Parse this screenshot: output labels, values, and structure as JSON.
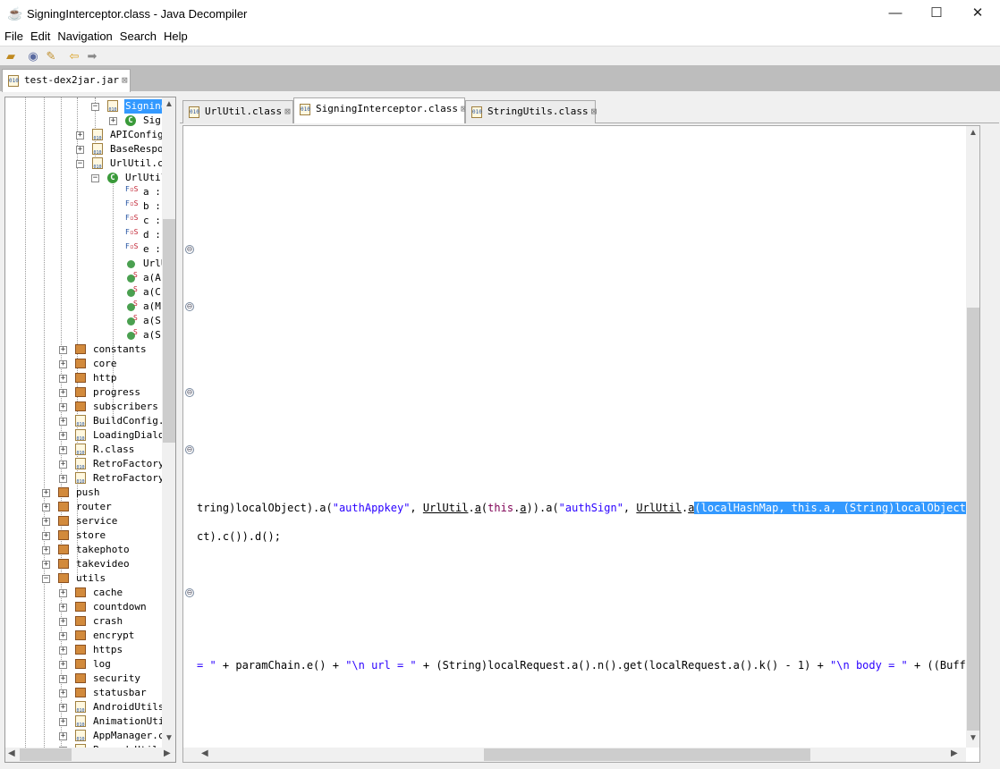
{
  "window": {
    "title": "SigningInterceptor.class - Java Decompiler",
    "minimize": "—",
    "maximize": "☐",
    "close": "✕"
  },
  "menu": [
    "File",
    "Edit",
    "Navigation",
    "Search",
    "Help"
  ],
  "toolbar": {
    "icons": [
      "open-folder-icon",
      "open-type-icon",
      "search-icon",
      "back-arrow-icon",
      "forward-arrow-icon"
    ]
  },
  "file_tab": {
    "label": "test-dex2jar.jar",
    "close": "⊠"
  },
  "tree": [
    {
      "label": "SigningI",
      "type": "class",
      "level": 5,
      "exp": "−",
      "selected": true
    },
    {
      "label": "Sig",
      "type": "c",
      "level": 6,
      "exp": "+"
    },
    {
      "label": "APIConfig.",
      "type": "class",
      "level": 4,
      "exp": "+"
    },
    {
      "label": "BaseRespor",
      "type": "class",
      "level": 4,
      "exp": "+"
    },
    {
      "label": "UrlUtil.cl",
      "type": "class",
      "level": 4,
      "exp": "−"
    },
    {
      "label": "UrlUtil",
      "type": "c",
      "level": 5,
      "exp": "−"
    },
    {
      "label": "a :",
      "type": "field",
      "level": 6
    },
    {
      "label": "b :",
      "type": "field",
      "level": 6
    },
    {
      "label": "c :",
      "type": "field",
      "level": 6
    },
    {
      "label": "d :",
      "type": "field",
      "level": 6
    },
    {
      "label": "e :",
      "type": "field",
      "level": 6
    },
    {
      "label": "UrlU",
      "type": "method",
      "level": 6
    },
    {
      "label": "a(A",
      "type": "smethod",
      "level": 6
    },
    {
      "label": "a(C",
      "type": "smethod",
      "level": 6
    },
    {
      "label": "a(M",
      "type": "smethod",
      "level": 6
    },
    {
      "label": "a(S",
      "type": "smethod",
      "level": 6
    },
    {
      "label": "a(S",
      "type": "smethod",
      "level": 6
    },
    {
      "label": "constants",
      "type": "pkg",
      "level": 3,
      "exp": "+"
    },
    {
      "label": "core",
      "type": "pkg",
      "level": 3,
      "exp": "+"
    },
    {
      "label": "http",
      "type": "pkg",
      "level": 3,
      "exp": "+"
    },
    {
      "label": "progress",
      "type": "pkg",
      "level": 3,
      "exp": "+"
    },
    {
      "label": "subscribers",
      "type": "pkg",
      "level": 3,
      "exp": "+"
    },
    {
      "label": "BuildConfig.c",
      "type": "class",
      "level": 3,
      "exp": "+"
    },
    {
      "label": "LoadingDialog",
      "type": "class",
      "level": 3,
      "exp": "+"
    },
    {
      "label": "R.class",
      "type": "class",
      "level": 3,
      "exp": "+"
    },
    {
      "label": "RetroFactory$",
      "type": "class",
      "level": 3,
      "exp": "+"
    },
    {
      "label": "RetroFactory.",
      "type": "class",
      "level": 3,
      "exp": "+"
    },
    {
      "label": "push",
      "type": "pkg",
      "level": 2,
      "exp": "+"
    },
    {
      "label": "router",
      "type": "pkg",
      "level": 2,
      "exp": "+"
    },
    {
      "label": "service",
      "type": "pkg",
      "level": 2,
      "exp": "+"
    },
    {
      "label": "store",
      "type": "pkg",
      "level": 2,
      "exp": "+"
    },
    {
      "label": "takephoto",
      "type": "pkg",
      "level": 2,
      "exp": "+"
    },
    {
      "label": "takevideo",
      "type": "pkg",
      "level": 2,
      "exp": "+"
    },
    {
      "label": "utils",
      "type": "pkg",
      "level": 2,
      "exp": "−"
    },
    {
      "label": "cache",
      "type": "pkg",
      "level": 3,
      "exp": "+"
    },
    {
      "label": "countdown",
      "type": "pkg",
      "level": 3,
      "exp": "+"
    },
    {
      "label": "crash",
      "type": "pkg",
      "level": 3,
      "exp": "+"
    },
    {
      "label": "encrypt",
      "type": "pkg",
      "level": 3,
      "exp": "+"
    },
    {
      "label": "https",
      "type": "pkg",
      "level": 3,
      "exp": "+"
    },
    {
      "label": "log",
      "type": "pkg",
      "level": 3,
      "exp": "+"
    },
    {
      "label": "security",
      "type": "pkg",
      "level": 3,
      "exp": "+"
    },
    {
      "label": "statusbar",
      "type": "pkg",
      "level": 3,
      "exp": "+"
    },
    {
      "label": "AndroidUtils.",
      "type": "class",
      "level": 3,
      "exp": "+"
    },
    {
      "label": "AnimationUtil",
      "type": "class",
      "level": 3,
      "exp": "+"
    },
    {
      "label": "AppManager.cl",
      "type": "class",
      "level": 3,
      "exp": "+"
    },
    {
      "label": "BarcodeUtil",
      "type": "class",
      "level": 3,
      "exp": "+"
    }
  ],
  "editor_tabs": [
    {
      "label": "UrlUtil.class",
      "close": "⊠",
      "active": false
    },
    {
      "label": "SigningInterceptor.class",
      "close": "⊠",
      "active": true
    },
    {
      "label": "StringUtils.class",
      "close": "⊠",
      "active": false
    }
  ],
  "code": {
    "line1": [
      [
        "",
        "tring)localObject).a("
      ],
      [
        "str",
        "\"authAppkey\""
      ],
      [
        "",
        ", "
      ],
      [
        "u",
        "UrlUtil"
      ],
      [
        "",
        "."
      ],
      [
        "u",
        "a"
      ],
      [
        "",
        "("
      ],
      [
        "kw",
        "this"
      ],
      [
        "",
        "."
      ],
      [
        "u",
        "a"
      ],
      [
        "",
        "))."
      ],
      [
        "",
        "a("
      ],
      [
        "str",
        "\"authSign\""
      ],
      [
        "",
        ", "
      ],
      [
        "u",
        "UrlUtil"
      ],
      [
        "",
        "."
      ],
      [
        "u",
        "a"
      ],
      [
        "hl",
        "(localHashMap, this.a, (String)localObject)"
      ],
      [
        "",
        ");"
      ]
    ],
    "line2": "ct).c()).d();",
    "line3": [
      [
        "str",
        "= \""
      ],
      [
        "",
        " + paramChain.e() + "
      ],
      [
        "str",
        "\"\\n url = \""
      ],
      [
        "",
        " + (String)localRequest.a().n().get(localRequest.a().k() - 1) + "
      ],
      [
        "str",
        "\"\\n body = \""
      ],
      [
        "",
        " + ((Buffer)l"
      ]
    ]
  },
  "fold_marker": "⊖",
  "colors": {
    "selection": "#3399ff",
    "string": "#2a00ff",
    "keyword": "#7f0055"
  }
}
